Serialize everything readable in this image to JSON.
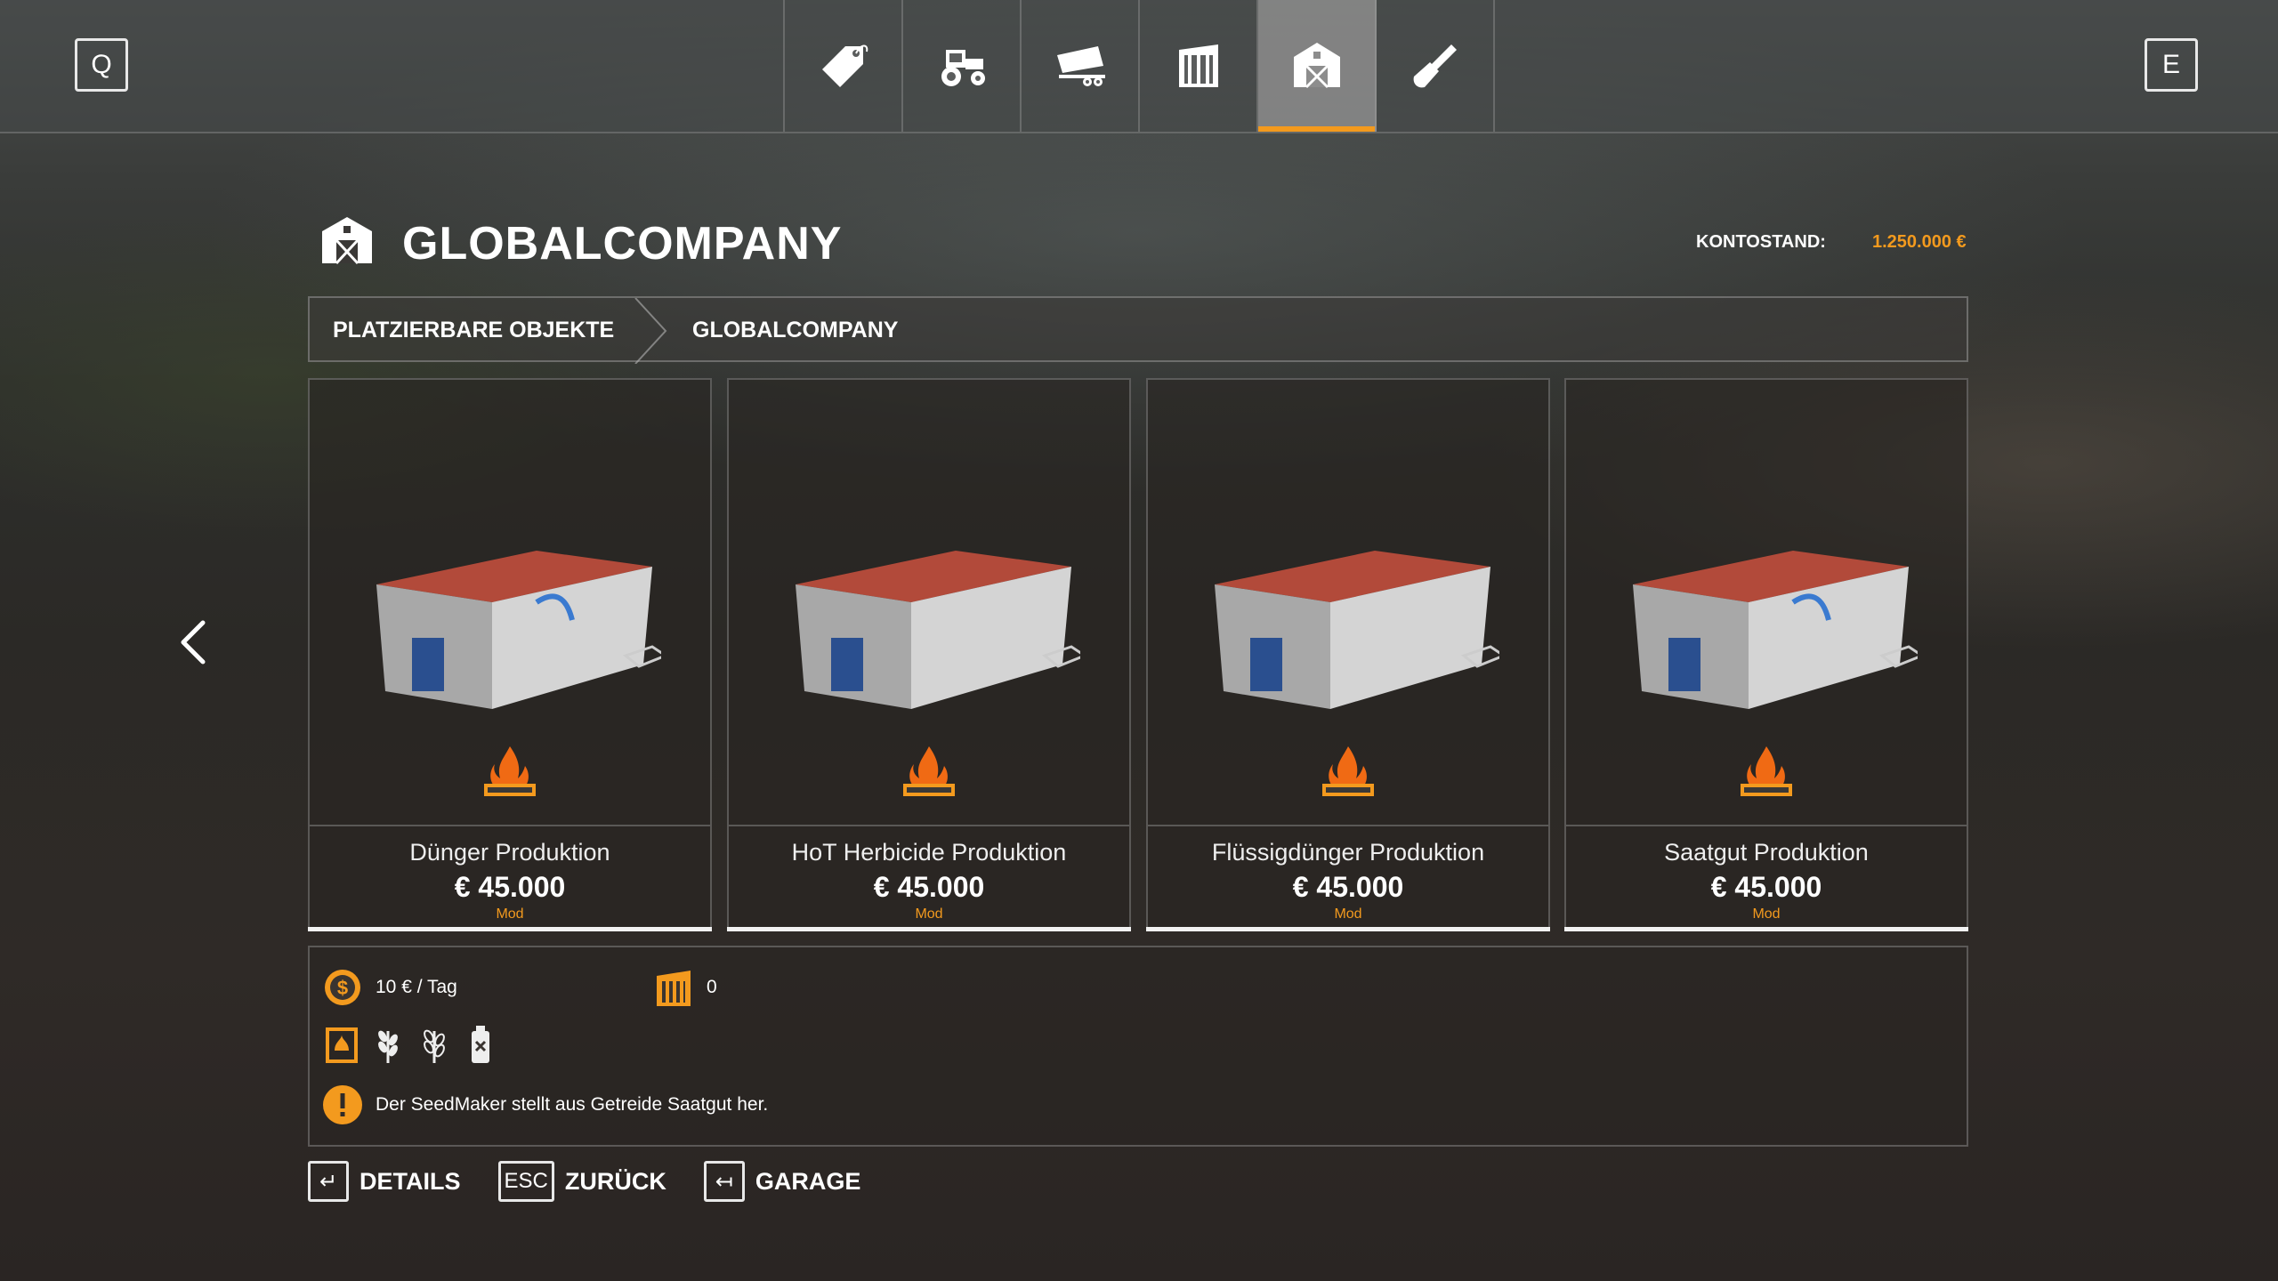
{
  "top_bar": {
    "left_key": "Q",
    "right_key": "E",
    "tabs": [
      {
        "icon": "price-tag-icon",
        "active": false
      },
      {
        "icon": "tractor-icon",
        "active": false
      },
      {
        "icon": "trailer-icon",
        "active": false
      },
      {
        "icon": "silo-icon",
        "active": false
      },
      {
        "icon": "barn-icon",
        "active": true
      },
      {
        "icon": "shovel-icon",
        "active": false
      }
    ]
  },
  "header": {
    "icon": "barn-icon",
    "title": "GLOBALCOMPANY",
    "balance_label": "KONTOSTAND:",
    "balance_value": "1.250.000 €"
  },
  "breadcrumb": [
    "PLATZIERBARE OBJEKTE",
    "GLOBALCOMPANY"
  ],
  "items": [
    {
      "name": "Dünger Produktion",
      "price": "€ 45.000",
      "source": "Mod",
      "selected": true
    },
    {
      "name": "HoT Herbicide Produktion",
      "price": "€ 45.000",
      "source": "Mod",
      "selected": false
    },
    {
      "name": "Flüssigdünger Produktion",
      "price": "€ 45.000",
      "source": "Mod",
      "selected": false
    },
    {
      "name": "Saatgut Produktion",
      "price": "€ 45.000",
      "source": "Mod",
      "selected": false
    }
  ],
  "details": {
    "upkeep": "10 € / Tag",
    "capacity": "0",
    "fill_types": [
      "fertilizer-icon",
      "wheat-icon",
      "barley-icon",
      "herbicide-bottle-icon"
    ],
    "description": "Der SeedMaker stellt aus Getreide Saatgut her."
  },
  "footer": [
    {
      "key": "↵",
      "label": "DETAILS"
    },
    {
      "key": "ESC",
      "label": "ZURÜCK"
    },
    {
      "key": "↤",
      "label": "GARAGE"
    }
  ],
  "colors": {
    "accent": "#f39a1e",
    "text": "#ffffff"
  }
}
